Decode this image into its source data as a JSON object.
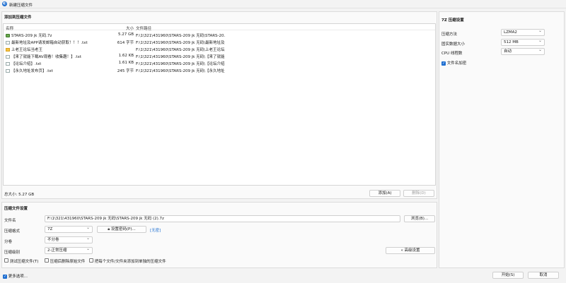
{
  "window": {
    "title": "新建压缩文件"
  },
  "add_section": {
    "title": "添加到压缩文件"
  },
  "file_list": {
    "headers": {
      "name": "名称",
      "size": "大小",
      "path": "文件路径"
    },
    "rows": [
      {
        "name": "STARS-209 jk 无码.7z",
        "size": "5.27 GB",
        "path": "F:\\1\\321\\431960\\STARS-209 jk 无码\\STARS-20...",
        "icon": "archive"
      },
      {
        "name": "最新地址及APP请发邮箱自动获取！！！.txt",
        "size": "614 字节",
        "path": "F:\\1\\321\\431960\\STARS-209 jk 无码\\最新地址及...",
        "icon": "file"
      },
      {
        "name": "上老王论坛当老王",
        "size": "",
        "path": "F:\\1\\321\\431960\\STARS-209 jk 无码\\上老王论坛...",
        "icon": "folder"
      },
      {
        "name": "【来了就能下载AV观看！收集趣！】.txt",
        "size": "1.62 KB",
        "path": "F:\\1\\321\\431960\\STARS-209 jk 无码\\【来了就能...",
        "icon": "file"
      },
      {
        "name": "【论坛介绍】.txt",
        "size": "1.61 KB",
        "path": "F:\\1\\321\\431960\\STARS-209 jk 无码\\【论坛介绍...",
        "icon": "file"
      },
      {
        "name": "【永久地址发布页】.txt",
        "size": "245 字节",
        "path": "F:\\1\\321\\431960\\STARS-209 jk 无码\\【永久地址...",
        "icon": "file"
      }
    ]
  },
  "total_size": "总大小: 5.27 GB",
  "buttons": {
    "add": "添加(A)",
    "delete": "删除(D)",
    "browse": "浏览(B)...",
    "set_password": "设置密码(P)...",
    "advanced": "« 高级设置",
    "start": "开始(S)",
    "cancel": "取消"
  },
  "settings_section": {
    "title": "压缩文件设置"
  },
  "filename": {
    "label": "文件名",
    "value": "F:\\1\\321\\431960\\STARS-209 jk 无码\\STARS-209 jk 无码 (2).7z"
  },
  "format": {
    "label": "压缩格式",
    "value": "7Z"
  },
  "encryption_status": "[无密]",
  "split": {
    "label": "分卷",
    "value": "不分卷"
  },
  "level": {
    "label": "压缩级别",
    "value": "2-正常压缩"
  },
  "options": {
    "test": "测试压缩文件(T)",
    "delete_after": "压缩后删除原始文件",
    "each_separate": "把每个文件/文件夹添加到单独的压缩文件"
  },
  "more_options": "更多选项...",
  "right_panel": {
    "title": "7Z 压缩设置",
    "method": {
      "label": "压缩方法",
      "value": "LZMA2"
    },
    "dict": {
      "label": "固实数据大小",
      "value": "512 MB"
    },
    "threads": {
      "label": "CPU 线程数",
      "value": "自动"
    },
    "encrypt_names": "文件名加密"
  },
  "colors": {
    "accent": "#1f6fd1",
    "folder": "#f5c244",
    "archive": "#6aa84f"
  }
}
